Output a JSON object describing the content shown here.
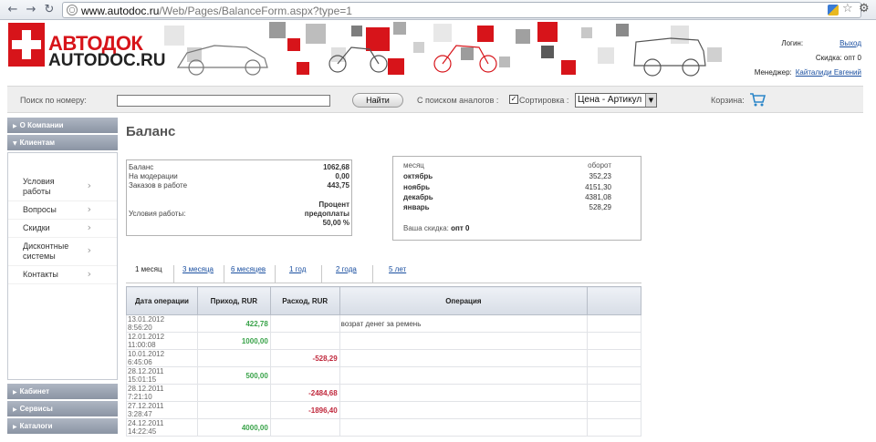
{
  "browser": {
    "url_host": "www.autodoc.ru",
    "url_path": "/Web/Pages/BalanceForm.aspx?type=1",
    "icons": [
      "back-icon",
      "forward-icon",
      "reload-icon",
      "globe-icon",
      "extension-icon",
      "star-icon",
      "wrench-icon"
    ]
  },
  "header": {
    "logo_ru": "АВТОДОК",
    "logo_en": "AUTODOC.RU",
    "login_label": "Логин:",
    "logout_link": "Выход",
    "discount_text": "Скидка: опт 0",
    "manager_label": "Менеджер:",
    "manager_name": "Кайталиди Евгений"
  },
  "search": {
    "label": "Поиск по номеру:",
    "value": "",
    "button": "Найти",
    "analogs_label": "С поиском аналогов :",
    "analogs_checked": true,
    "sort_label": "Сортировка :",
    "sort_value": "Цена - Артикул",
    "cart_label": "Корзина:"
  },
  "sidebar": {
    "sections": [
      {
        "label": "О Компании"
      },
      {
        "label": "Клиентам"
      },
      {
        "label": "Кабинет"
      },
      {
        "label": "Сервисы"
      },
      {
        "label": "Каталоги"
      }
    ],
    "items": [
      {
        "label": "Условия работы"
      },
      {
        "label": "Вопросы"
      },
      {
        "label": "Скидки"
      },
      {
        "label": "Дисконтные системы"
      },
      {
        "label": "Контакты"
      }
    ]
  },
  "page": {
    "title": "Баланс"
  },
  "balance": {
    "rows": [
      {
        "label": "Баланс",
        "value": "1062,68"
      },
      {
        "label": "На модерации",
        "value": "0,00"
      },
      {
        "label": "Заказов в работе",
        "value": "443,75"
      }
    ],
    "terms_label": "Условия работы:",
    "terms_line1": "Процент",
    "terms_line2": "предоплаты",
    "terms_line3": "50,00 %"
  },
  "turnover": {
    "header_month": "месяц",
    "header_value": "оборот",
    "rows": [
      {
        "month": "октябрь",
        "value": "352,23"
      },
      {
        "month": "ноябрь",
        "value": "4151,30"
      },
      {
        "month": "декабрь",
        "value": "4381,08"
      },
      {
        "month": "январь",
        "value": "528,29"
      }
    ],
    "discount_label": "Ваша скидка:",
    "discount_value": "опт 0"
  },
  "periods": [
    "1 месяц",
    "3 месяца",
    "6 месяцев",
    "1 год",
    "2 года",
    "5 лет"
  ],
  "operations": {
    "columns": [
      "Дата операции",
      "Приход, RUR",
      "Расход, RUR",
      "Операция"
    ],
    "rows": [
      {
        "date": "13.01.2012",
        "time": "8:56:20",
        "income": "422,78",
        "expense": "",
        "desc": "возрат денег за ремень"
      },
      {
        "date": "12.01.2012",
        "time": "11:00:08",
        "income": "1000,00",
        "expense": "",
        "desc": ""
      },
      {
        "date": "10.01.2012",
        "time": "6:45:06",
        "income": "",
        "expense": "-528,29",
        "desc": ""
      },
      {
        "date": "28.12.2011",
        "time": "15:01:15",
        "income": "500,00",
        "expense": "",
        "desc": ""
      },
      {
        "date": "28.12.2011",
        "time": "7:21:10",
        "income": "",
        "expense": "-2484,68",
        "desc": ""
      },
      {
        "date": "27.12.2011",
        "time": "3:28:47",
        "income": "",
        "expense": "-1896,40",
        "desc": ""
      },
      {
        "date": "24.12.2011",
        "time": "14:22:45",
        "income": "4000,00",
        "expense": "",
        "desc": ""
      }
    ]
  }
}
